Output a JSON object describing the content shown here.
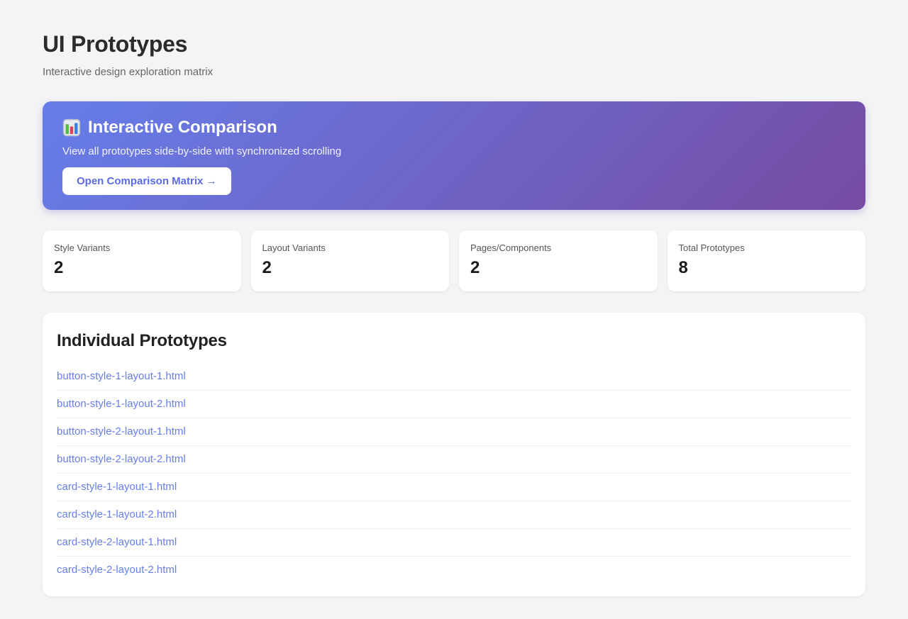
{
  "page": {
    "title": "UI Prototypes",
    "subtitle": "Interactive design exploration matrix"
  },
  "banner": {
    "icon": "bar-chart-emoji",
    "title": "Interactive Comparison",
    "description": "View all prototypes side-by-side with synchronized scrolling",
    "button_label": "Open Comparison Matrix →",
    "gradient_from": "#667eea",
    "gradient_to": "#764ba2"
  },
  "stats": [
    {
      "label": "Style Variants",
      "value": "2"
    },
    {
      "label": "Layout Variants",
      "value": "2"
    },
    {
      "label": "Pages/Components",
      "value": "2"
    },
    {
      "label": "Total Prototypes",
      "value": "8"
    }
  ],
  "prototypes": {
    "heading": "Individual Prototypes",
    "items": [
      "button-style-1-layout-1.html",
      "button-style-1-layout-2.html",
      "button-style-2-layout-1.html",
      "button-style-2-layout-2.html",
      "card-style-1-layout-1.html",
      "card-style-1-layout-2.html",
      "card-style-2-layout-1.html",
      "card-style-2-layout-2.html"
    ]
  },
  "colors": {
    "background": "#f4f4f5",
    "link": "#667eea",
    "button_text": "#5b6be8"
  }
}
